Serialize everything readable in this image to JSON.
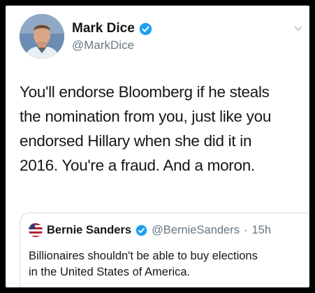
{
  "tweet": {
    "author": {
      "name": "Mark Dice",
      "handle": "@MarkDice",
      "avatar_icon": "profile-photo",
      "verified_icon": "verified-badge-icon"
    },
    "text_lines": [
      "You'll endorse Bloomberg if he steals",
      "the nomination from you, just like you",
      "endorsed Hillary when she did it in",
      "2016.  You're a fraud.  And a moron."
    ],
    "menu_icon": "chevron-down-icon"
  },
  "quoted_tweet": {
    "author": {
      "name": "Bernie Sanders",
      "handle": "@BernieSanders",
      "separator": "·",
      "time": "15h",
      "avatar_icon": "flag-avatar",
      "verified_icon": "verified-badge-icon"
    },
    "text_lines": [
      "Billionaires shouldn't be able to buy elections",
      "in the United States of America."
    ]
  },
  "colors": {
    "verified_blue": "#1da1f2",
    "text": "#14171a",
    "secondary_text": "#657786",
    "border": "#d6dde3"
  }
}
